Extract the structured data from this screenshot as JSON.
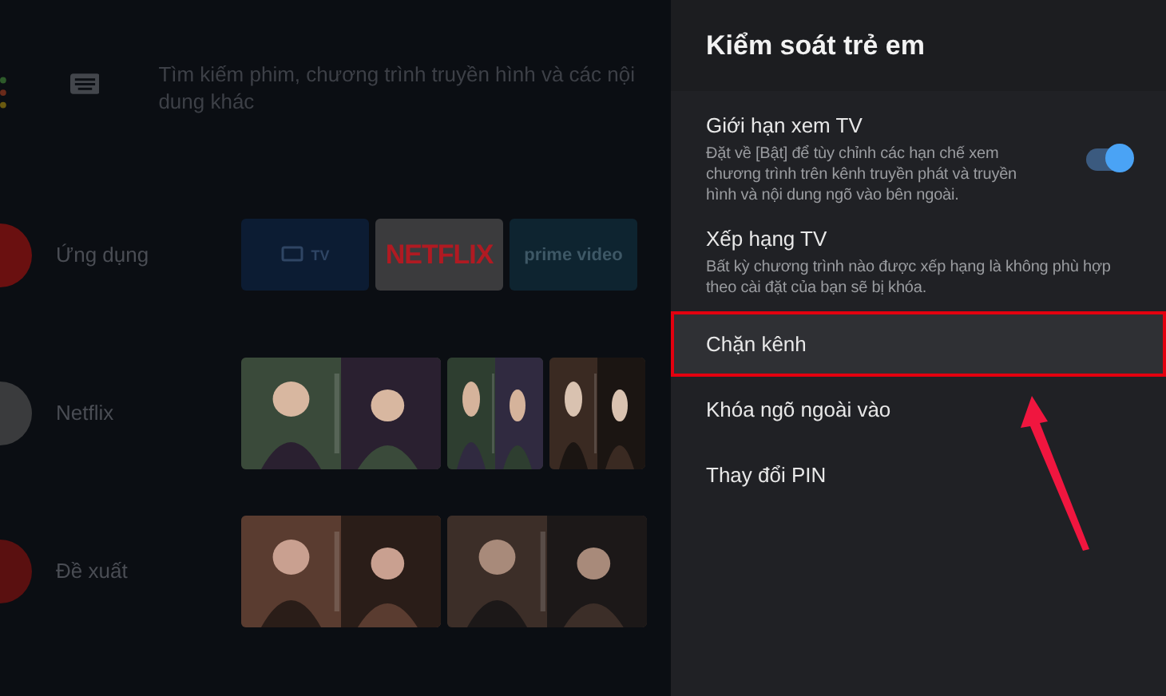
{
  "background": {
    "search": {
      "placeholder": "Tìm kiếm phim, chương trình truyền hình và các nội dung khác"
    },
    "rows": [
      {
        "label": "Ứng dụng",
        "kind": "apps",
        "tiles": [
          {
            "kind": "tv",
            "label": "TV"
          },
          {
            "kind": "netflix",
            "label": "NETFLIX"
          },
          {
            "kind": "prime",
            "label": "prime video"
          }
        ]
      },
      {
        "label": "Netflix",
        "kind": "posters"
      },
      {
        "label": "Đề xuất",
        "kind": "posters"
      }
    ]
  },
  "panel": {
    "title": "Kiểm soát trẻ em",
    "items": [
      {
        "title": "Giới hạn xem TV",
        "description": "Đặt về [Bật] để tùy chỉnh các hạn chế xem chương trình trên kênh truyền phát và truyền hình và nội dung ngõ vào bên ngoài.",
        "kind": "toggle",
        "on": true,
        "selected": false
      },
      {
        "title": "Xếp hạng TV",
        "description": "Bất kỳ chương trình nào được xếp hạng là không phù hợp theo cài đặt của bạn sẽ bị khóa.",
        "kind": "plain",
        "selected": false
      },
      {
        "title": "Chặn kênh",
        "kind": "plain",
        "selected": true
      },
      {
        "title": "Khóa ngõ ngoài vào",
        "kind": "plain",
        "selected": false
      },
      {
        "title": "Thay đổi PIN",
        "kind": "plain",
        "selected": false
      }
    ]
  }
}
